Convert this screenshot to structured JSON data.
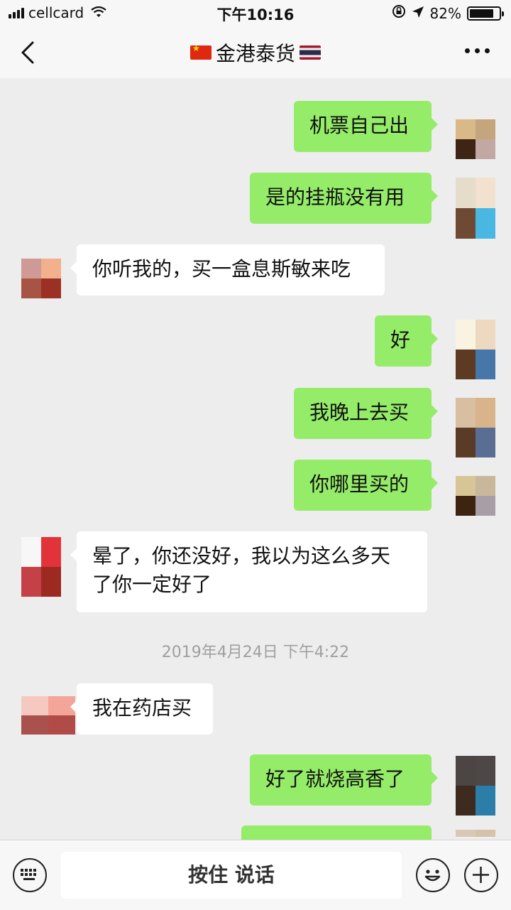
{
  "status_bar": {
    "carrier": "cellcard",
    "time": "下午10:16",
    "battery": "82%",
    "battery_level": 0.82
  },
  "nav": {
    "title": "金港泰货",
    "left_flag": "china-flag",
    "right_flag": "thailand-flag",
    "back_icon": "chevron-left-icon",
    "more_icon": "more-dots-icon"
  },
  "messages": [
    {
      "side": "out",
      "text": "机票自己出"
    },
    {
      "side": "out",
      "text": "是的挂瓶没有用"
    },
    {
      "side": "in",
      "text": "你听我的，买一盒息斯敏来吃"
    },
    {
      "side": "out",
      "text": "好"
    },
    {
      "side": "out",
      "text": "我晚上去买"
    },
    {
      "side": "out",
      "text": "你哪里买的"
    },
    {
      "side": "in",
      "text": "晕了，你还没好，我以为这么多天\n了你一定好了"
    },
    {
      "timestamp": "2019年4月24日 下午4:22"
    },
    {
      "side": "in",
      "text": "我在药店买"
    },
    {
      "side": "out",
      "text": "好了就烧高香了"
    }
  ],
  "input_bar": {
    "voice_label": "按住 说话",
    "left_icon": "keyboard-icon",
    "emoji_icon": "emoji-icon",
    "plus_icon": "plus-icon"
  },
  "colors": {
    "outgoing_bubble": "#95ec69",
    "incoming_bubble": "#ffffff",
    "chat_background": "#ededed"
  }
}
